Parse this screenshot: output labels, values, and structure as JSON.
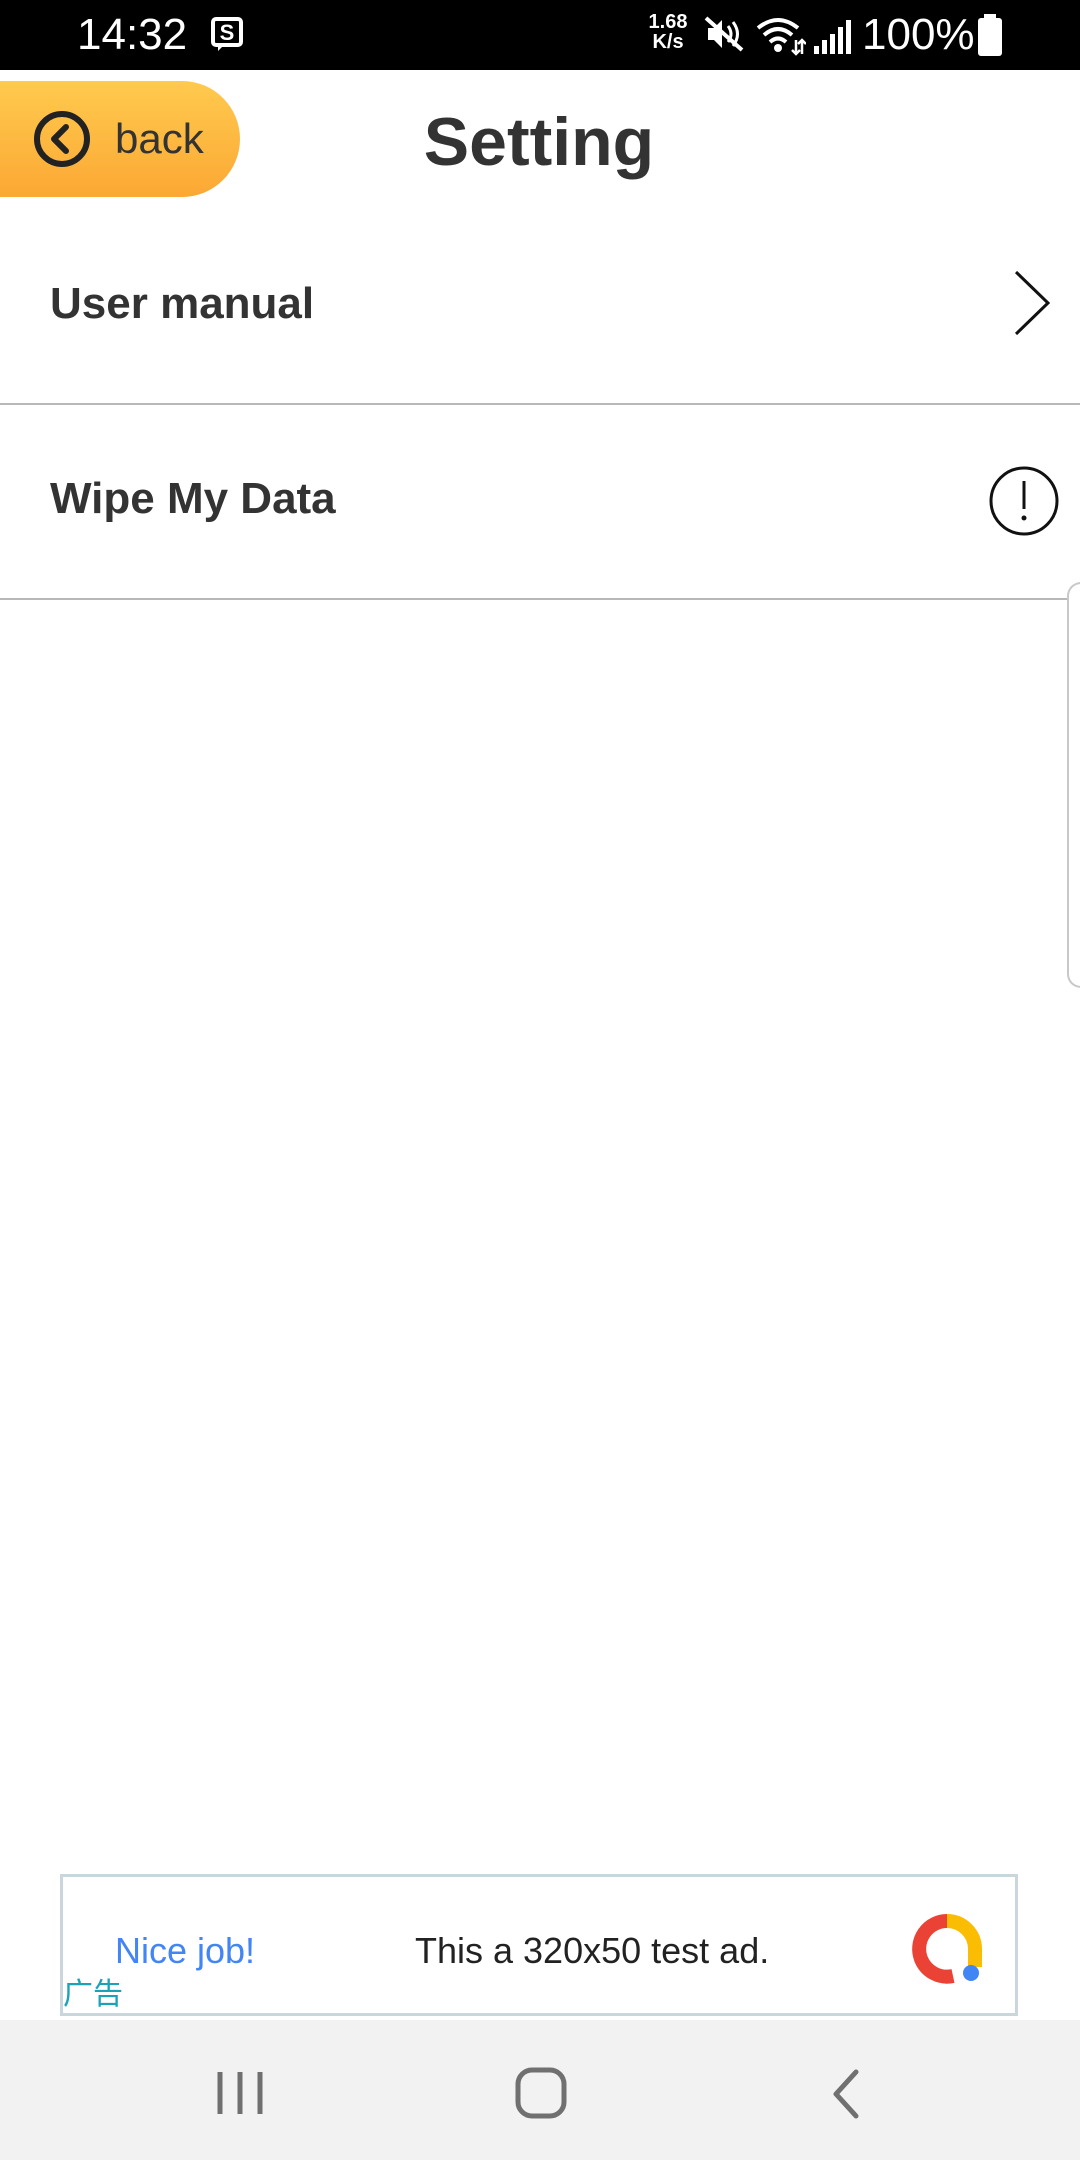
{
  "status_bar": {
    "time": "14:32",
    "network_speed": "1.68",
    "network_speed_unit": "K/s",
    "battery": "100%",
    "icons": [
      "s-notification-icon",
      "mute-icon",
      "wifi-icon",
      "signal-icon",
      "battery-icon"
    ]
  },
  "header": {
    "back_label": "back",
    "back_icon": "chevron-left-circle-icon",
    "title": "Setting",
    "accent_color": "#fdb93f"
  },
  "settings": {
    "items": [
      {
        "label": "User manual",
        "icon": "chevron-right-icon"
      },
      {
        "label": "Wipe My Data",
        "icon": "alert-circle-icon"
      }
    ]
  },
  "ad": {
    "headline": "Nice job!",
    "body": "This a 320x50 test ad.",
    "badge": "广告",
    "icon": "ad-logo-icon"
  },
  "nav_bar": {
    "icons": [
      "recents-icon",
      "home-icon",
      "back-icon"
    ]
  }
}
